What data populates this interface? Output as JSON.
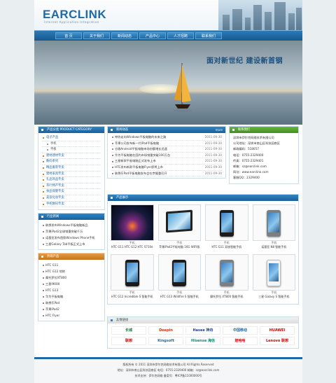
{
  "header": {
    "logo_main": "EARCLINK",
    "slogan": "Internet Application Integration"
  },
  "nav": [
    "首  页",
    "关于我们",
    "新闻动态",
    "产品中心",
    "人才招聘",
    "联系我们"
  ],
  "banner": {
    "title": "面对新世纪  建设新首钢"
  },
  "categories": {
    "title": "产品分类 PRODUCT CATEGORY",
    "items": [
      {
        "label": "电子产品",
        "sub": false
      },
      {
        "label": "手机",
        "sub": true
      },
      {
        "label": "平板",
        "sub": true
      },
      {
        "label": "建材建材专卖",
        "sub": false
      },
      {
        "label": "数码系列",
        "sub": false
      },
      {
        "label": "精品服装专卖",
        "sub": false
      },
      {
        "label": "建材家具专卖",
        "sub": false
      },
      {
        "label": "礼品饰品专卖",
        "sub": false
      },
      {
        "label": "茶叶特产专卖",
        "sub": false
      },
      {
        "label": "食品保健专卖",
        "sub": false
      },
      {
        "label": "美容化妆专卖",
        "sub": false
      },
      {
        "label": "手机数码专卖",
        "sub": false
      }
    ]
  },
  "news": {
    "title": "新闻动态",
    "more": "more",
    "items": [
      {
        "title": "带你走向Windows平板电脑的未来之路",
        "date": "2011-09-30"
      },
      {
        "title": "苹果公司发布新一代iPad平板电脑",
        "date": "2011-09-30"
      },
      {
        "title": "谷歌Android平板电脑市场份额增长迅速",
        "date": "2011-09-30"
      },
      {
        "title": "华为平板电脑在国内市场销量突破100万台",
        "date": "2011-09-30"
      },
      {
        "title": "三星新款平板电脑正式发布上市",
        "date": "2011-09-30"
      },
      {
        "title": "HTC发布新款平板电脑Flyer即将上市",
        "date": "2011-09-30"
      },
      {
        "title": "联想乐Pad平板电脑发布会在京隆重召开",
        "date": "2011-09-30"
      }
    ]
  },
  "contact": {
    "title": "联系我们",
    "lines": [
      "深圳市伊尔克网络技术有限公司",
      "公司地址：深圳市南山区科技园南区",
      "邮政编码：518057",
      "电话：0755-2329400",
      "传真：0755-2329401",
      "邮箱：sz@earclink.com",
      "网址：www.earclink.com",
      "客服QQ：2329400"
    ]
  },
  "news_side": {
    "title": "行业新闻",
    "items": [
      "联想发布Windows平板电脑新品",
      "苹果iPad2全球销量突破千万",
      "诺基亚发布首款Windows Phone手机",
      "三星Galaxy Tab平板正式上市"
    ]
  },
  "hot_side": {
    "title": "热销产品",
    "items": [
      "HTC G11",
      "HTC G12 惊艳",
      "摩托罗拉XT800",
      "三星I9000",
      "HTC G13",
      "华为平板电脑",
      "联想乐Pad",
      "苹果iPad2",
      "HTC Flyer"
    ]
  },
  "products": {
    "title": "产品展示",
    "items": [
      {
        "title": "HTC G11 HTC G12 HTC S710e",
        "label": "手机",
        "img": "night"
      },
      {
        "title": "苹果iPad2平板电脑 16G WIFI版",
        "label": "手机",
        "img": "tablet"
      },
      {
        "title": "HTC G11 双核智能手机",
        "label": "手机",
        "img": "phone"
      },
      {
        "title": "诺基亚 N8 智能手机",
        "label": "手机",
        "img": "phone-silver"
      },
      {
        "title": "HTC G12 Incredible S 智能手机",
        "label": "手机",
        "img": "phone"
      },
      {
        "title": "HTC G13 Wildfire S 智能手机",
        "label": "手机",
        "img": "phone"
      },
      {
        "title": "摩托罗拉 XT800 智能手机",
        "label": "手机",
        "img": "phone-silver"
      },
      {
        "title": "三星 Galaxy S 智能手机",
        "label": "手机",
        "img": "phone-white"
      }
    ]
  },
  "links": {
    "title": "友情链接",
    "items": [
      "长城",
      "Deepin",
      "Hasee 神舟",
      "中国移动",
      "HUAWEI",
      "联想",
      "Kingsoft",
      "Hisense 海信",
      "娃哈哈",
      "Lenovo 联想"
    ]
  },
  "footer": {
    "lines": [
      "版权所有 © 2011 深圳市伊尔克网络技术有限公司 All Rights Reserved",
      "地址：深圳市南山区科技园南区  电话：0755-2329400  邮箱：sz@earclink.com",
      "技术支持：伊尔克网络  备案号：粤ICP备11000000号"
    ]
  }
}
